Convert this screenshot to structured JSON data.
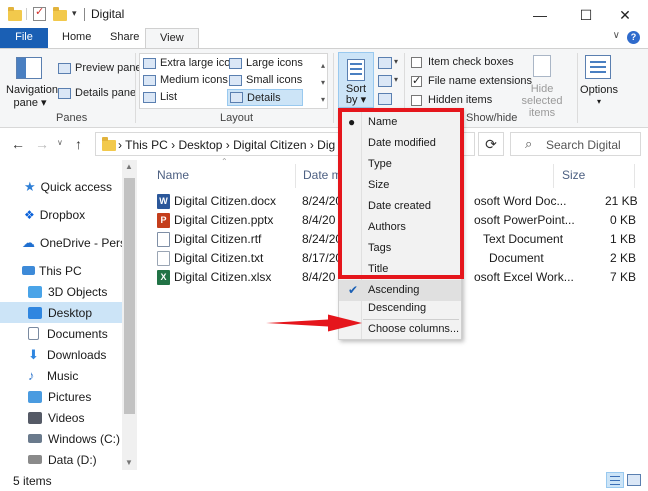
{
  "window": {
    "title": "Digital",
    "minimize_glyph": "—",
    "maximize_glyph": "☐",
    "close_glyph": "✕"
  },
  "tabs": [
    {
      "label": "File"
    },
    {
      "label": "Home"
    },
    {
      "label": "Share"
    },
    {
      "label": "View"
    }
  ],
  "ribbon": {
    "panes": {
      "navigation_pane": "Navigation pane",
      "navigation_pane_line1": "Navigation",
      "navigation_pane_line2": "pane ▾",
      "preview_pane": "Preview pane",
      "details_pane": "Details pane",
      "group_label": "Panes"
    },
    "layout": {
      "items": [
        {
          "label": "Extra large icons"
        },
        {
          "label": "Large icons"
        },
        {
          "label": "Medium icons"
        },
        {
          "label": "Small icons"
        },
        {
          "label": "List"
        },
        {
          "label": "Details"
        }
      ],
      "selected": "Details",
      "group_label": "Layout"
    },
    "current_view": {
      "sort_line1": "Sort",
      "sort_line2": "by ▾"
    },
    "show_hide": {
      "item_check_boxes": "Item check boxes",
      "file_name_extensions": "File name extensions",
      "hidden_items": "Hidden items",
      "hide_selected_line1": "Hide selected",
      "hide_selected_line2": "items",
      "group_label": "Show/hide",
      "checked": {
        "item_check_boxes": false,
        "file_name_extensions": true,
        "hidden_items": false
      }
    },
    "options": {
      "label": "Options",
      "chevron": "▾"
    }
  },
  "address": {
    "crumbs": "›  This PC  ›  Desktop  ›  Digital Citizen  ›  Dig",
    "search_placeholder": "Search Digital"
  },
  "nav": {
    "items": [
      {
        "label": "Quick access",
        "color": "#2f7fd6"
      },
      {
        "label": "Dropbox",
        "color": "#0a61d9"
      },
      {
        "label": "OneDrive - Person",
        "color": "#1f6fd0"
      },
      {
        "label": "This PC",
        "color": "#3d8ad8"
      },
      {
        "label": "3D Objects",
        "color": "#4aa4e8"
      },
      {
        "label": "Desktop",
        "color": "#2f86e0"
      },
      {
        "label": "Documents",
        "color": "#7a8aa0"
      },
      {
        "label": "Downloads",
        "color": "#2f86e0"
      },
      {
        "label": "Music",
        "color": "#3d7fd0"
      },
      {
        "label": "Pictures",
        "color": "#4a9be0"
      },
      {
        "label": "Videos",
        "color": "#555a66"
      },
      {
        "label": "Windows (C:)",
        "color": "#6a7a8c"
      },
      {
        "label": "Data (D:)",
        "color": "#8a8a8a"
      }
    ],
    "selected": "Desktop"
  },
  "columns": {
    "name": "Name",
    "date_modified": "Date m",
    "size": "Size"
  },
  "files": [
    {
      "name": "Digital Citizen.docx",
      "date": "8/24/20",
      "type": "osoft Word Doc...",
      "size": "21 KB",
      "icon": "W",
      "color": "#2b579a"
    },
    {
      "name": "Digital Citizen.pptx",
      "date": "8/4/20",
      "type": "osoft PowerPoint...",
      "size": "0 KB",
      "icon": "P",
      "color": "#c43e1c"
    },
    {
      "name": "Digital Citizen.rtf",
      "date": "8/24/20",
      "type": "Text Document",
      "size": "1 KB",
      "icon": "",
      "color": "#7f8fa6"
    },
    {
      "name": "Digital Citizen.txt",
      "date": "8/17/20",
      "type": "Document",
      "size": "2 KB",
      "icon": "",
      "color": "#9aa5b4"
    },
    {
      "name": "Digital Citizen.xlsx",
      "date": "8/4/20",
      "type": "osoft Excel Work...",
      "size": "7 KB",
      "icon": "X",
      "color": "#217346"
    }
  ],
  "sort_menu": {
    "items": [
      {
        "label": "Name",
        "mark": "●"
      },
      {
        "label": "Date modified",
        "mark": ""
      },
      {
        "label": "Type",
        "mark": ""
      },
      {
        "label": "Size",
        "mark": ""
      },
      {
        "label": "Date created",
        "mark": ""
      },
      {
        "label": "Authors",
        "mark": ""
      },
      {
        "label": "Tags",
        "mark": ""
      },
      {
        "label": "Title",
        "mark": ""
      },
      {
        "label": "Ascending",
        "mark": "✔"
      },
      {
        "label": "Descending",
        "mark": ""
      },
      {
        "label": "Choose columns...",
        "mark": ""
      }
    ]
  },
  "status": {
    "text": "5 items"
  },
  "accent": {
    "red": "#e5161c",
    "blue": "#1a5fb4",
    "selection": "#cce4f7"
  }
}
